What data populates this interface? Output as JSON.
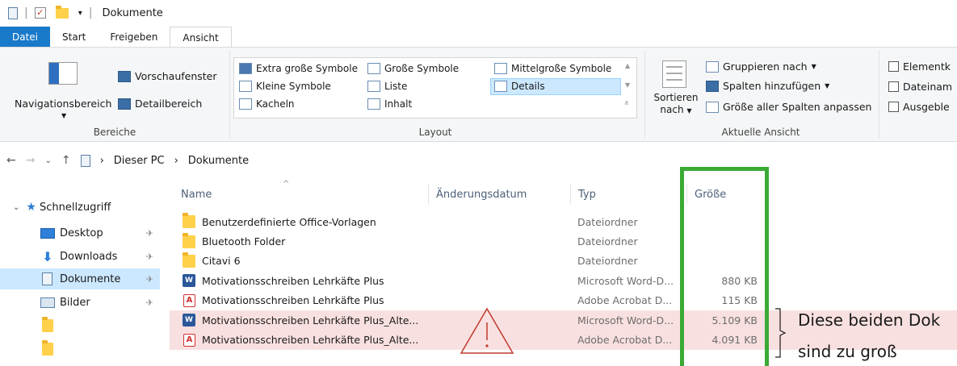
{
  "window": {
    "title": "Dokumente"
  },
  "tabs": [
    "Datei",
    "Start",
    "Freigeben",
    "Ansicht"
  ],
  "ribbon": {
    "bereiche": {
      "nav_pane": "Navigationsbereich",
      "preview": "Vorschaufenster",
      "details": "Detailbereich",
      "label": "Bereiche"
    },
    "layout": {
      "items": [
        "Extra große Symbole",
        "Große Symbole",
        "Mittelgroße Symbole",
        "Kleine Symbole",
        "Liste",
        "Details",
        "Kacheln",
        "Inhalt"
      ],
      "label": "Layout"
    },
    "current_view": {
      "sort_line1": "Sortieren",
      "sort_line2": "nach",
      "group_by": "Gruppieren nach",
      "add_columns": "Spalten hinzufügen",
      "fit_columns": "Größe aller Spalten anpassen",
      "label": "Aktuelle Ansicht"
    },
    "show_hide": {
      "items": [
        "Elementk",
        "Dateinam",
        "Ausgeble"
      ]
    }
  },
  "address": {
    "crumbs": [
      "Dieser PC",
      "Dokumente"
    ]
  },
  "navpane": {
    "quick_access": "Schnellzugriff",
    "items": [
      "Desktop",
      "Downloads",
      "Dokumente",
      "Bilder"
    ]
  },
  "columns": {
    "name": "Name",
    "date": "Änderungsdatum",
    "type": "Typ",
    "size": "Größe"
  },
  "files": [
    {
      "name": "Benutzerdefinierte Office-Vorlagen",
      "type": "Dateiordner",
      "size": "",
      "icon": "folder-icon"
    },
    {
      "name": "Bluetooth Folder",
      "type": "Dateiordner",
      "size": "",
      "icon": "folder-icon"
    },
    {
      "name": "Citavi 6",
      "type": "Dateiordner",
      "size": "",
      "icon": "folder-icon"
    },
    {
      "name": "Motivationsschreiben Lehrkäfte Plus",
      "type": "Microsoft Word-D...",
      "size": "880 KB",
      "icon": "word-icon"
    },
    {
      "name": "Motivationsschreiben Lehrkäfte Plus",
      "type": "Adobe Acrobat D...",
      "size": "115 KB",
      "icon": "pdf-icon"
    },
    {
      "name": "Motivationsschreiben Lehrkäfte Plus_Alte...",
      "type": "Microsoft Word-D...",
      "size": "5.109 KB",
      "icon": "word-icon"
    },
    {
      "name": "Motivationsschreiben Lehrkäfte Plus_Alte...",
      "type": "Adobe Acrobat D...",
      "size": "4.091 KB",
      "icon": "pdf-icon"
    }
  ],
  "annotation": {
    "line1": "Diese beiden Dok",
    "line2": "sind zu groß",
    "highlight_color": "#3aaa35",
    "warning_color": "#c0392b"
  }
}
